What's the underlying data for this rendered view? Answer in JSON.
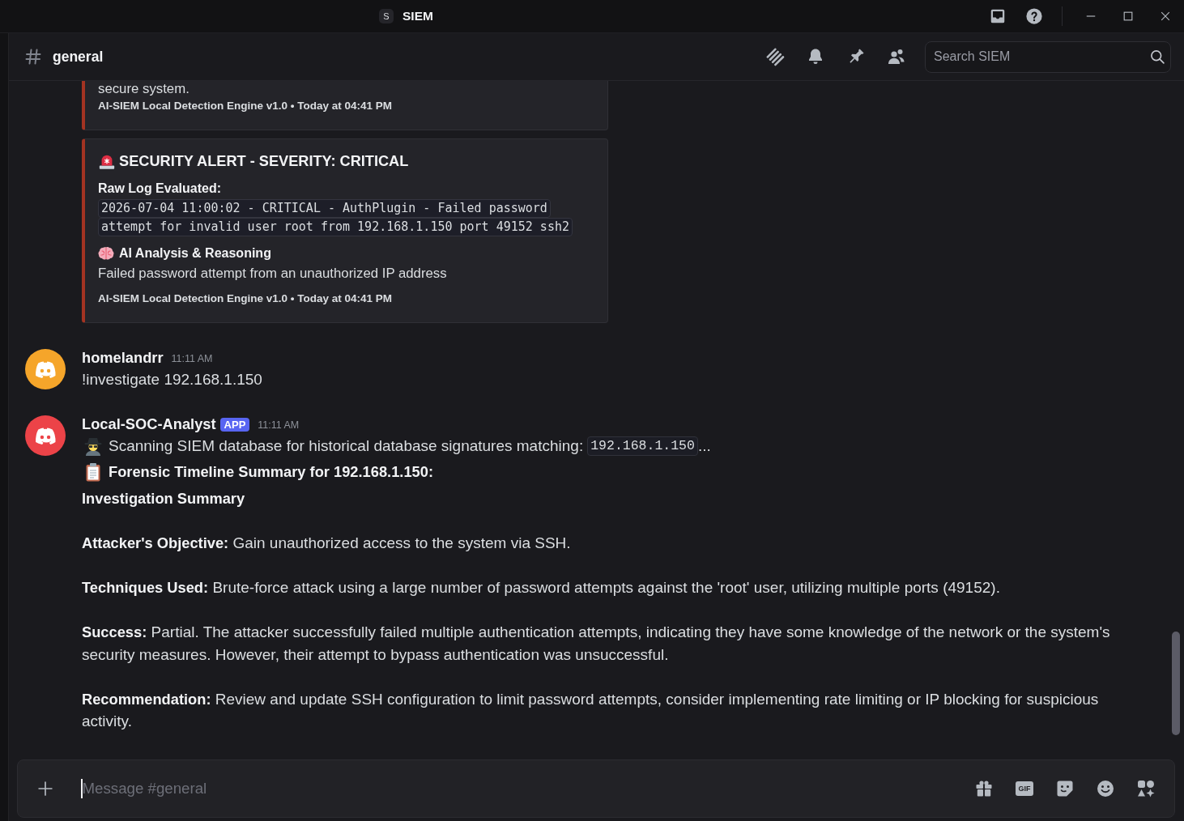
{
  "title_bar": {
    "server_initial": "S",
    "title": "SIEM"
  },
  "channel": {
    "name": "general",
    "search": {
      "placeholder": "Search SIEM"
    }
  },
  "embeds": [
    {
      "kind": "partial",
      "description": "secure system.",
      "footer": "AI-SIEM Local Detection Engine v1.0 • Today at 04:41 PM"
    },
    {
      "kind": "full",
      "title": "SECURITY ALERT - SEVERITY: CRITICAL",
      "fields": [
        {
          "kind": "log",
          "name": "Raw Log Evaluated:",
          "lines": [
            "2026-07-04 11:00:02 - CRITICAL - AuthPlugin - Failed password",
            "attempt for invalid user root from 192.168.1.150 port 49152 ssh2"
          ]
        },
        {
          "kind": "analysis",
          "name": "AI Analysis & Reasoning",
          "value": "Failed password attempt from an unauthorized IP address"
        }
      ],
      "footer": "AI-SIEM Local Detection Engine v1.0 • Today at 04:41 PM"
    }
  ],
  "messages": [
    {
      "author": "homelandrr",
      "color": "#f5a52a",
      "time": "11:11 AM",
      "lines": [
        {
          "kind": "plain",
          "text": "!investigate 192.168.1.150"
        }
      ]
    },
    {
      "author": "Local-SOC-Analyst",
      "badge": "APP",
      "color": "#ec4348",
      "time": "11:11 AM",
      "lines": [
        {
          "kind": "scan",
          "text": "Scanning SIEM database for historical database signatures matching:",
          "code": "192.168.1.150",
          "suffix": "..."
        },
        {
          "kind": "heading",
          "text": "Forensic Timeline Summary for 192.168.1.150:"
        },
        {
          "kind": "subheading",
          "text": "Investigation Summary"
        },
        {
          "kind": "paragraph",
          "text": "**Attacker's Objective:** Gain unauthorized access to the system via SSH."
        },
        {
          "kind": "paragraph",
          "text": "**Techniques Used:** Brute-force attack using a large number of password attempts against the 'root' user, utilizing multiple ports (49152)."
        },
        {
          "kind": "paragraph",
          "text": "**Success:** Partial. The attacker successfully failed multiple authentication attempts, indicating they have some knowledge of the network or the system's security measures. However, their attempt to bypass authentication was unsuccessful."
        },
        {
          "kind": "paragraph",
          "text": "**Recommendation:** Review and update SSH configuration to limit password attempts, consider implementing rate limiting or IP blocking for suspicious activity."
        }
      ]
    }
  ],
  "composer": {
    "placeholder": "Message #general",
    "gif_label": "GIF"
  }
}
